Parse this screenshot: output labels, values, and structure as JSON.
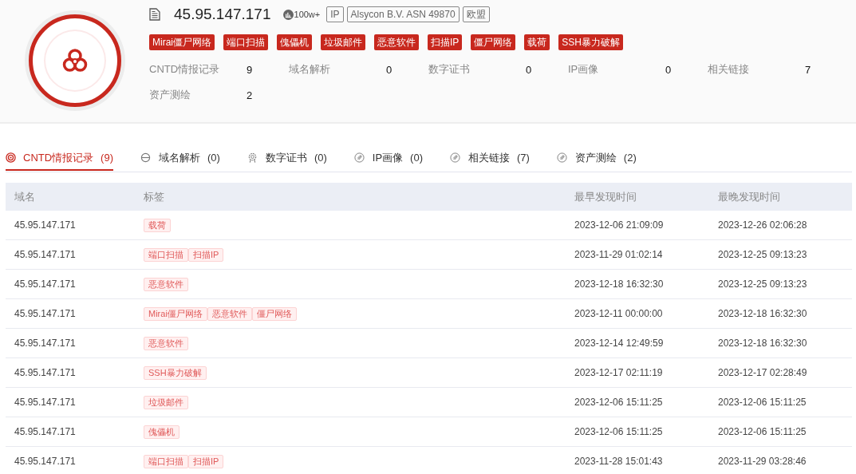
{
  "header": {
    "ip": "45.95.147.171",
    "popularity": "100w+",
    "badges": [
      "IP",
      "Alsycon B.V. ASN 49870",
      "欧盟"
    ],
    "threat_tags": [
      "Mirai僵尸网络",
      "端口扫描",
      "傀儡机",
      "垃圾邮件",
      "恶意软件",
      "扫描IP",
      "僵尸网络",
      "载荷",
      "SSH暴力破解"
    ],
    "stats": [
      {
        "label": "CNTD情报记录",
        "value": "9"
      },
      {
        "label": "域名解析",
        "value": "0"
      },
      {
        "label": "数字证书",
        "value": "0"
      },
      {
        "label": "IP画像",
        "value": "0"
      },
      {
        "label": "相关链接",
        "value": "7"
      },
      {
        "label": "资产测绘",
        "value": "2"
      }
    ]
  },
  "tabs": [
    {
      "label": "CNTD情报记录",
      "count": "(9)",
      "selected": true,
      "kind": "radar"
    },
    {
      "label": "域名解析",
      "count": "(0)",
      "selected": false,
      "kind": "dns"
    },
    {
      "label": "数字证书",
      "count": "(0)",
      "selected": false,
      "kind": "cert"
    },
    {
      "label": "IP画像",
      "count": "(0)",
      "selected": false,
      "kind": "link"
    },
    {
      "label": "相关链接",
      "count": "(7)",
      "selected": false,
      "kind": "link"
    },
    {
      "label": "资产测绘",
      "count": "(2)",
      "selected": false,
      "kind": "link"
    }
  ],
  "table": {
    "columns": [
      "域名",
      "标签",
      "最早发现时间",
      "最晚发现时间"
    ],
    "rows": [
      {
        "domain": "45.95.147.171",
        "tags": [
          "载荷"
        ],
        "first_seen": "2023-12-06 21:09:09",
        "last_seen": "2023-12-26 02:06:28"
      },
      {
        "domain": "45.95.147.171",
        "tags": [
          "端口扫描",
          "扫描IP"
        ],
        "first_seen": "2023-11-29 01:02:14",
        "last_seen": "2023-12-25 09:13:23"
      },
      {
        "domain": "45.95.147.171",
        "tags": [
          "恶意软件"
        ],
        "first_seen": "2023-12-18 16:32:30",
        "last_seen": "2023-12-25 09:13:23"
      },
      {
        "domain": "45.95.147.171",
        "tags": [
          "Mirai僵尸网络",
          "恶意软件",
          "僵尸网络"
        ],
        "first_seen": "2023-12-11 00:00:00",
        "last_seen": "2023-12-18 16:32:30"
      },
      {
        "domain": "45.95.147.171",
        "tags": [
          "恶意软件"
        ],
        "first_seen": "2023-12-14 12:49:59",
        "last_seen": "2023-12-18 16:32:30"
      },
      {
        "domain": "45.95.147.171",
        "tags": [
          "SSH暴力破解"
        ],
        "first_seen": "2023-12-17 02:11:19",
        "last_seen": "2023-12-17 02:28:49"
      },
      {
        "domain": "45.95.147.171",
        "tags": [
          "垃圾邮件"
        ],
        "first_seen": "2023-12-06 15:11:25",
        "last_seen": "2023-12-06 15:11:25"
      },
      {
        "domain": "45.95.147.171",
        "tags": [
          "傀儡机"
        ],
        "first_seen": "2023-12-06 15:11:25",
        "last_seen": "2023-12-06 15:11:25"
      },
      {
        "domain": "45.95.147.171",
        "tags": [
          "端口扫描",
          "扫描IP"
        ],
        "first_seen": "2023-11-28 15:01:43",
        "last_seen": "2023-11-29 03:28:46"
      }
    ]
  }
}
